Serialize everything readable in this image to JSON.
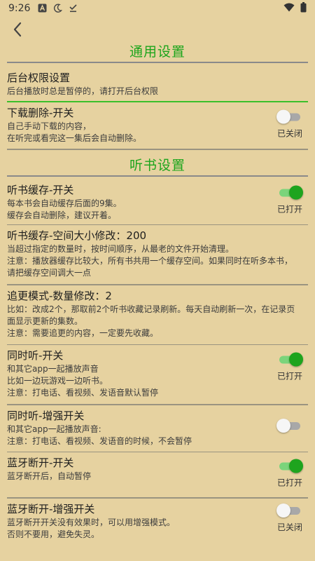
{
  "status_bar": {
    "time": "9:26",
    "left_icons": [
      "android-a-icon",
      "moon-icon",
      "download-done-icon"
    ],
    "right_icons": [
      "wifi-icon",
      "battery-icon"
    ]
  },
  "header": {
    "back_icon": "chevron-left-icon"
  },
  "colors": {
    "background": "#E6D2A0",
    "section_title": "#1CA51C",
    "toggle_on": "#1EA41E",
    "toggle_off": "#F6F6F6"
  },
  "sections": [
    {
      "title": "通用设置",
      "items": [
        {
          "title": "后台权限设置",
          "lines": [
            "后台播放时总是暂停的，请打开后台权限"
          ]
        },
        {
          "title": "下载删除-开关",
          "lines": [
            "自己手动下载的内容，",
            "在听完或看完这一集后会自动删除。"
          ],
          "toggle": {
            "on": false,
            "state_label": "已关闭"
          }
        }
      ]
    },
    {
      "title": "听书设置",
      "items": [
        {
          "title": "听书缓存-开关",
          "lines": [
            "每本书会自动缓存后面的9集。",
            "缓存会自动删除，建议开着。"
          ],
          "toggle": {
            "on": true,
            "state_label": "已打开"
          }
        },
        {
          "title": "听书缓存-空间大小修改：200",
          "lines": [
            "当超过指定的数量时，按时间顺序，从最老的文件开始清理。",
            "注意：播放器缓存比较大，所有书共用一个缓存空间。如果同时在听多本书，",
            "请把缓存空间调大一点"
          ]
        },
        {
          "title": "追更模式-数量修改：2",
          "lines": [
            "比如：改成2个，那取前2个听书收藏记录刷新。每天自动刷新一次，在记录页",
            "面显示更新的集数。",
            "注意：需要追更的内容，一定要先收藏。"
          ]
        },
        {
          "title": "同时听-开关",
          "lines": [
            "和其它app一起播放声音",
            "比如一边玩游戏一边听书。",
            "注意：打电话、看视频、发语音默认暂停"
          ],
          "toggle": {
            "on": true,
            "state_label": "已打开"
          }
        },
        {
          "title": "同时听-增强开关",
          "lines": [
            "和其它app一起播放声音:",
            "注意：打电话、看视频、发语音的时候，不会暂停"
          ],
          "toggle": {
            "on": false,
            "state_label": "已关闭"
          }
        },
        {
          "title": "蓝牙断开-开关",
          "lines": [
            "蓝牙断开后，自动暂停"
          ],
          "toggle": {
            "on": true,
            "state_label": "已打开"
          }
        },
        {
          "title": "蓝牙断开-增强开关",
          "lines": [
            "蓝牙断开开关没有效果时，可以用增强模式。",
            "否则不要用，避免失灵。"
          ],
          "toggle": {
            "on": false,
            "state_label": "已关闭"
          }
        }
      ]
    }
  ]
}
